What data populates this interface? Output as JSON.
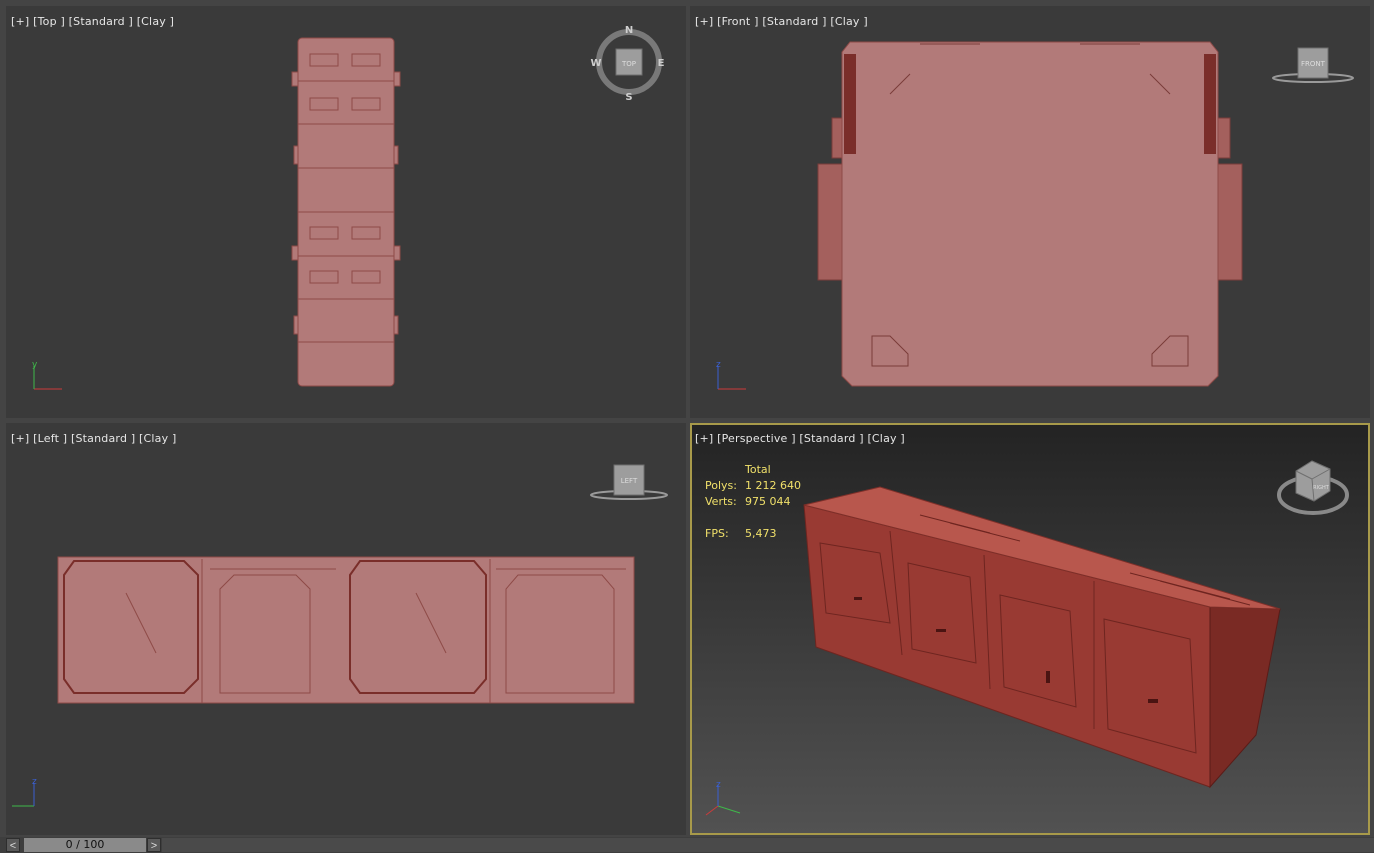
{
  "viewports": {
    "top": {
      "labels": [
        "[+]",
        "[Top ]",
        "[Standard ]",
        "[Clay ]"
      ],
      "viewcube": {
        "face": "TOP",
        "n": "N",
        "s": "S",
        "e": "E",
        "w": "W"
      }
    },
    "front": {
      "labels": [
        "[+]",
        "[Front ]",
        "[Standard ]",
        "[Clay ]"
      ],
      "viewcube": {
        "face": "FRONT"
      }
    },
    "left": {
      "labels": [
        "[+]",
        "[Left ]",
        "[Standard ]",
        "[Clay ]"
      ],
      "viewcube": {
        "face": "LEFT"
      }
    },
    "perspective": {
      "labels": [
        "[+]",
        "[Perspective ]",
        "[Standard ]",
        "[Clay ]"
      ],
      "active": true,
      "viewcube": {
        "face": "RIGHT"
      },
      "stats": {
        "header": "Total",
        "polys_label": "Polys:",
        "polys": "1 212 640",
        "verts_label": "Verts:",
        "verts": "975 044",
        "fps_label": "FPS:",
        "fps": "5,473"
      }
    }
  },
  "axes": {
    "x": "x",
    "y": "y",
    "z": "z"
  },
  "timeline": {
    "prev": "<",
    "next": ">",
    "frame": "0 / 100"
  },
  "colors": {
    "clay": "#b27a79",
    "clay_dark": "#8e4a47",
    "persp_clay": "#a8463e",
    "active_border": "#a89a4a",
    "stats_text": "#f0e06a"
  }
}
